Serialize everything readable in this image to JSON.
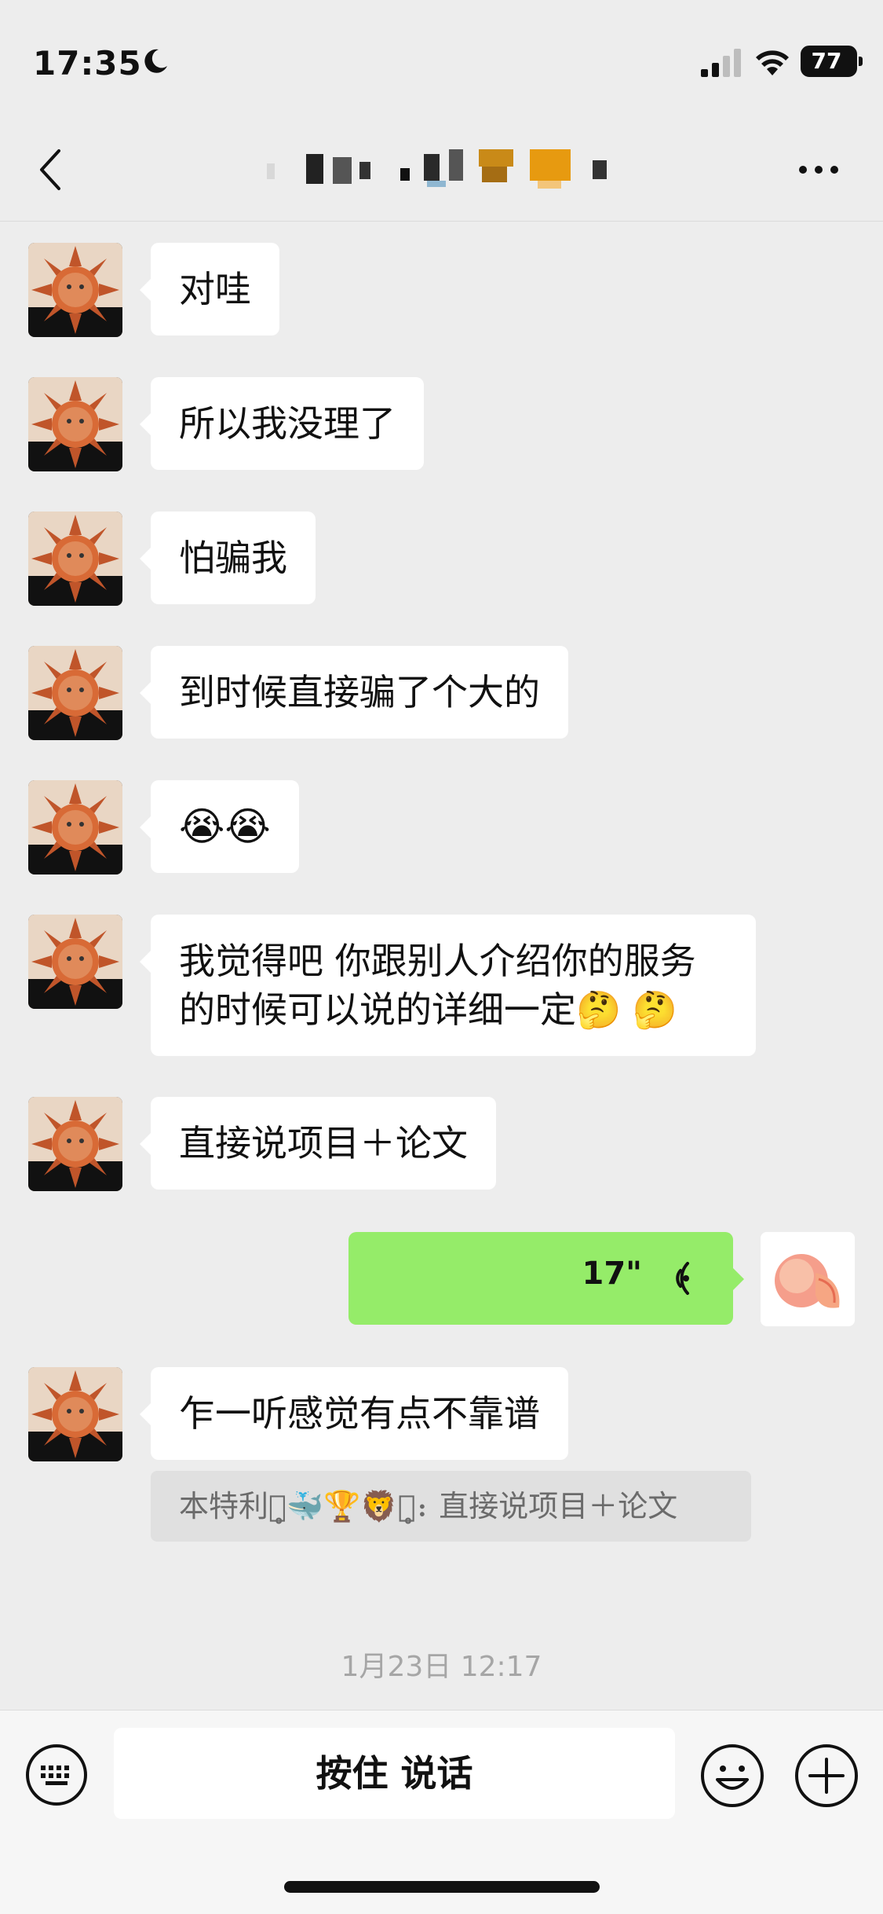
{
  "status_bar": {
    "time": "17:35",
    "battery": "77",
    "icons": [
      "moon-icon",
      "signal-icon",
      "wifi-icon",
      "battery-icon"
    ]
  },
  "nav": {
    "back_icon": "chevron-left-icon",
    "more_icon": "ellipsis-icon"
  },
  "messages": [
    {
      "sender": "other",
      "text": "对哇"
    },
    {
      "sender": "other",
      "text": "所以我没理了"
    },
    {
      "sender": "other",
      "text": "怕骗我"
    },
    {
      "sender": "other",
      "text": "到时候直接骗了个大的"
    },
    {
      "sender": "other",
      "text": "😭😭"
    },
    {
      "sender": "other",
      "text_line1": "我觉得吧 你跟别人介绍你的服务",
      "text_line2": "的时候可以说的详细一定🤔 🤔"
    },
    {
      "sender": "other",
      "text": "直接说项目＋论文"
    },
    {
      "sender": "me",
      "type": "voice",
      "duration": "17\""
    },
    {
      "sender": "other",
      "text": "乍一听感觉有点不靠谱"
    }
  ],
  "quote": {
    "text": "本特利ꈊ̥🐳🏆🦁ꈊ̥：直接说项目＋论文"
  },
  "timestamp": "1月23日 12:17",
  "input_bar": {
    "voice_button_label": "按住 说话",
    "icons": [
      "keyboard-icon",
      "emoji-icon",
      "plus-icon"
    ]
  },
  "colors": {
    "background": "#ededed",
    "bubble_mine": "#95ec69",
    "bubble_other": "#ffffff",
    "quote_bg": "#e0e0e0"
  }
}
